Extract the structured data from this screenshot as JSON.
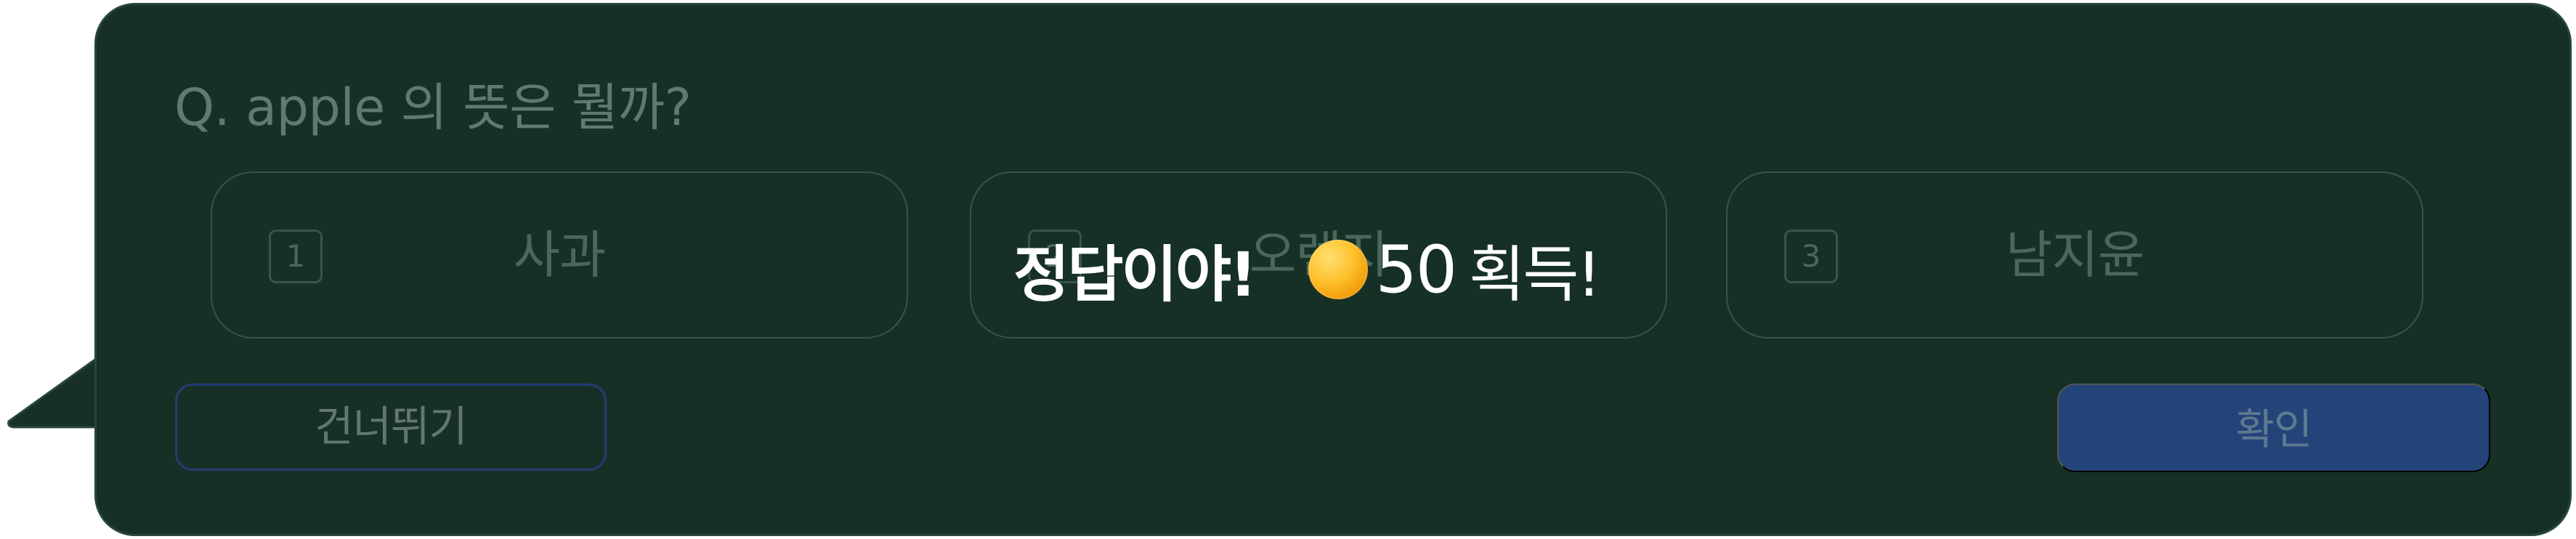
{
  "question": {
    "text": "Q. apple 의 뜻은 뭘까?"
  },
  "options": [
    {
      "number": "1",
      "label": "사과"
    },
    {
      "number": "2",
      "label": "오렌지"
    },
    {
      "number": "3",
      "label": "남지윤"
    }
  ],
  "feedback": {
    "title": "정답이야!",
    "coin_icon": "coin-icon",
    "amount": "50",
    "suffix": "획득!"
  },
  "actions": {
    "skip_label": "건너뛰기",
    "confirm_label": "확인"
  },
  "colors": {
    "panel": "#173026",
    "panel_border": "#27463a",
    "option_border": "#35554a",
    "primary_button": "#244479",
    "skip_border": "#233d75",
    "coin": "#ffc22f"
  }
}
